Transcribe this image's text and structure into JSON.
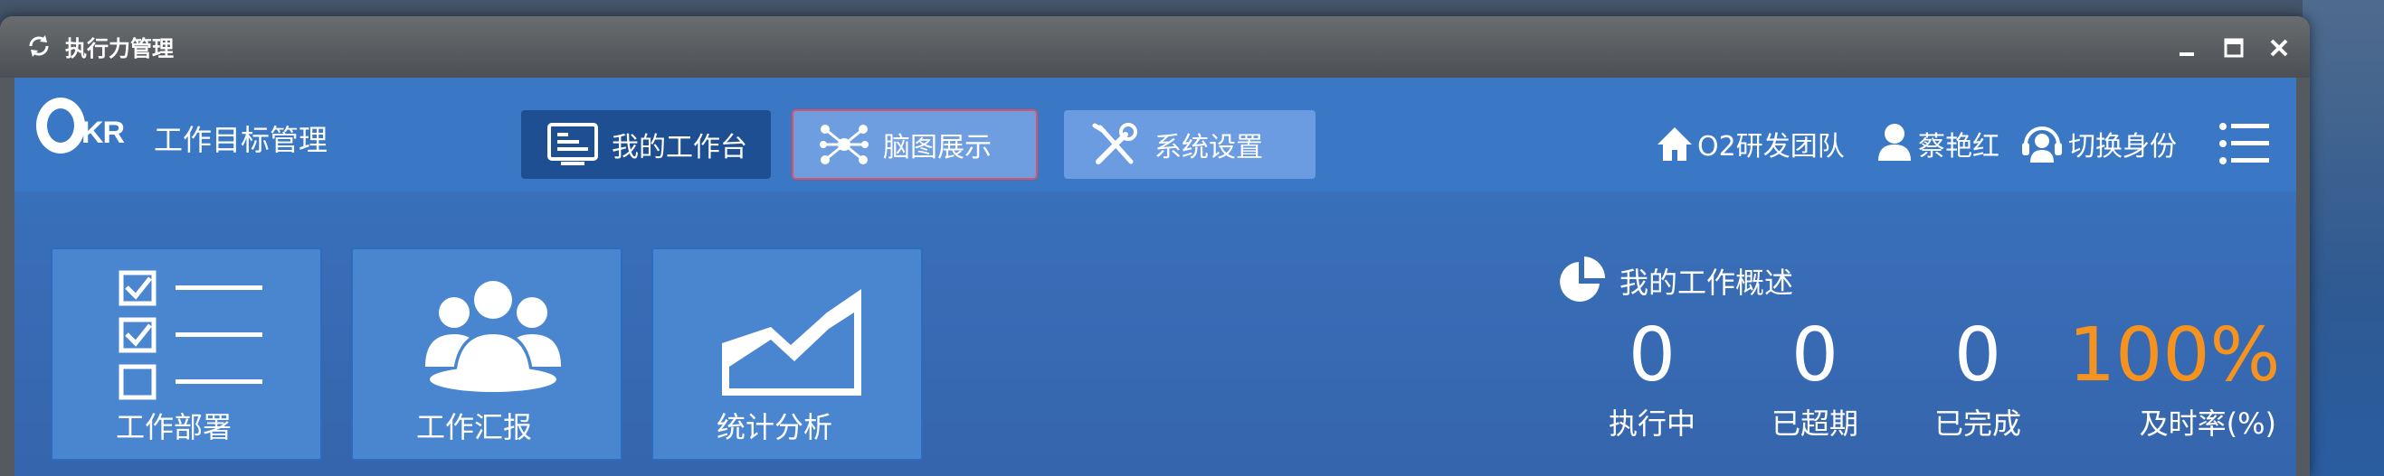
{
  "window": {
    "title": "执行力管理"
  },
  "logo": {
    "letter_o": "",
    "letters": "KR",
    "system_name": "工作目标管理"
  },
  "nav": {
    "workbench": "我的工作台",
    "mindmap": "脑图展示",
    "settings": "系统设置"
  },
  "header": {
    "team": "O2研发团队",
    "user": "蔡艳红",
    "switch_identity": "切换身份"
  },
  "tiles": {
    "deploy": "工作部署",
    "report": "工作汇报",
    "stats": "统计分析"
  },
  "summary": {
    "title": "我的工作概述",
    "stats": [
      {
        "value": "0",
        "label": "执行中"
      },
      {
        "value": "0",
        "label": "已超期"
      },
      {
        "value": "0",
        "label": "已完成"
      },
      {
        "value": "100%",
        "label": "及时率(%)"
      }
    ]
  },
  "colors": {
    "accent_orange": "#f6931e",
    "header_blue": "#3a78c6",
    "active_nav": "#1d4f92",
    "nav_button": "#6b9be0",
    "hover_outline": "#e05063"
  }
}
